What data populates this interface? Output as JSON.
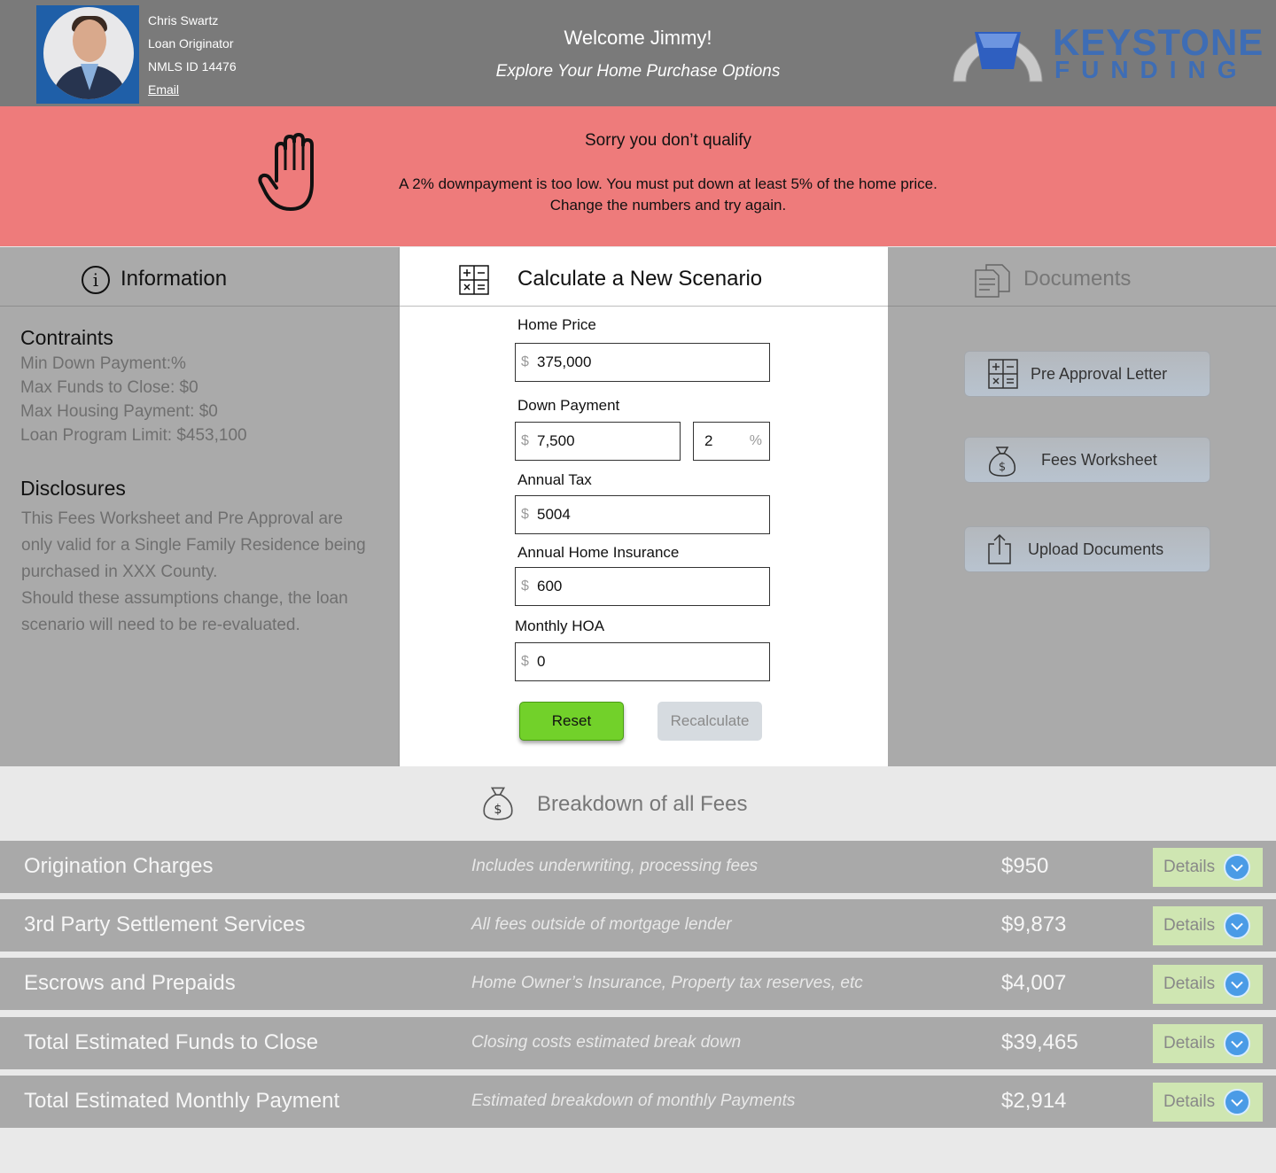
{
  "header": {
    "lo_name": "Chris Swartz",
    "lo_title": "Loan Originator",
    "lo_nmls": "NMLS ID 14476",
    "lo_email": "Email",
    "welcome": "Welcome Jimmy!",
    "subtitle": "Explore Your Home Purchase Options",
    "logo_line1": "KEYSTONE",
    "logo_line2": "FUNDING"
  },
  "alert": {
    "title": "Sorry you don’t qualify",
    "line1": "A 2% downpayment is too low. You must put down at least 5% of the home price.",
    "line2": "Change the numbers and try again.",
    "icon": "stop-hand-icon"
  },
  "info": {
    "title": "Information",
    "constraints_heading": "Contraints",
    "constraints": [
      "Min Down Payment:%",
      "Max Funds to Close: $0",
      "Max Housing Payment: $0",
      "Loan Program Limit: $453,100"
    ],
    "disclosures_heading": "Disclosures",
    "disclosures_lines": [
      "This Fees Worksheet and Pre Approval are",
      "only valid for a Single Family Residence being",
      "purchased in XXX County.",
      "Should these assumptions change, the loan",
      "scenario will need to be re-evaluated."
    ]
  },
  "calculator": {
    "title": "Calculate a New Scenario",
    "currency": "$",
    "percent_symbol": "%",
    "home_price_label": "Home Price",
    "home_price": "375,000",
    "down_payment_label": "Down Payment",
    "down_payment": "7,500",
    "down_payment_pct": "2",
    "annual_tax_label": "Annual Tax",
    "annual_tax": "5004",
    "insurance_label": "Annual Home Insurance",
    "insurance": "600",
    "hoa_label": "Monthly HOA",
    "hoa": "0",
    "reset_label": "Reset",
    "recalc_label": "Recalculate"
  },
  "documents": {
    "title": "Documents",
    "buttons": [
      {
        "label": "Pre Approval Letter",
        "icon": "calculator-icon"
      },
      {
        "label": "Fees Worksheet",
        "icon": "money-bag-icon"
      },
      {
        "label": "Upload Documents",
        "icon": "upload-icon"
      }
    ]
  },
  "fees": {
    "title": "Breakdown of all Fees",
    "details_label": "Details",
    "rows": [
      {
        "name": "Origination Charges",
        "desc": "Includes underwriting, processing fees",
        "amount": "$950"
      },
      {
        "name": "3rd Party Settlement Services",
        "desc": "All fees outside of mortgage lender",
        "amount": "$9,873"
      },
      {
        "name": "Escrows and Prepaids",
        "desc": "Home Owner’s Insurance, Property tax reserves, etc",
        "amount": "$4,007"
      },
      {
        "name": "Total Estimated Funds to Close",
        "desc": "Closing costs estimated break down",
        "amount": "$39,465"
      },
      {
        "name": "Total Estimated Monthly Payment",
        "desc": "Estimated breakdown of monthly Payments",
        "amount": "$2,914"
      }
    ]
  },
  "colors": {
    "alert_bg": "#ee7b7b",
    "reset_green": "#72d12a",
    "details_bg": "#cfe6b2",
    "brand_blue": "#3e6db5"
  }
}
